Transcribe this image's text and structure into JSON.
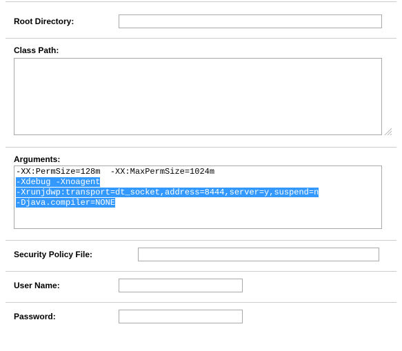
{
  "root_directory": {
    "label": "Root Directory:",
    "value": ""
  },
  "class_path": {
    "label": "Class Path:",
    "value": ""
  },
  "arguments": {
    "label": "Arguments:",
    "line1": "-XX:PermSize=128m  -XX:MaxPermSize=1024m",
    "highlighted": [
      "-Xdebug -Xnoagent",
      "-Xrunjdwp:transport=dt_socket,address=8444,server=y,suspend=n",
      "-Djava.compiler=NONE"
    ]
  },
  "security_policy": {
    "label": "Security Policy File:",
    "value": ""
  },
  "user_name": {
    "label": "User Name:",
    "value": ""
  },
  "password": {
    "label": "Password:",
    "value": ""
  }
}
